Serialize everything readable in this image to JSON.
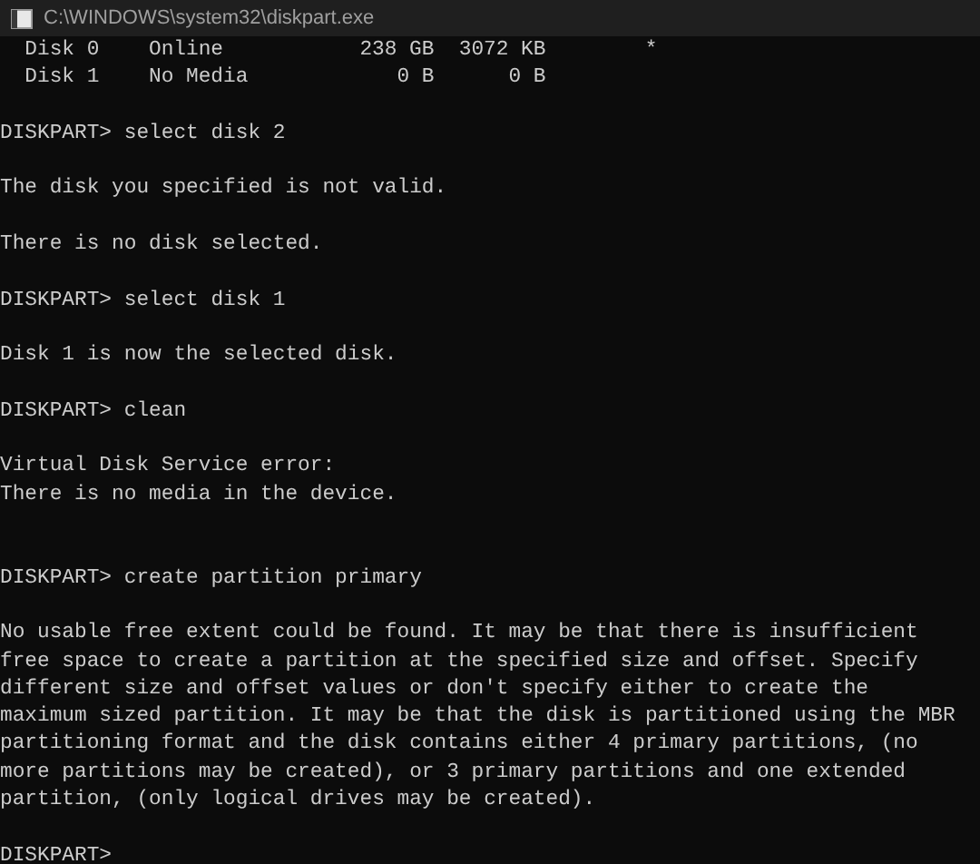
{
  "window": {
    "title": "C:\\WINDOWS\\system32\\diskpart.exe"
  },
  "disk_table": {
    "rows": [
      {
        "disk": "Disk 0",
        "status": "Online",
        "size": "238 GB",
        "free": "3072 KB",
        "gpt": "*"
      },
      {
        "disk": "Disk 1",
        "status": "No Media",
        "size": "0 B",
        "free": "0 B"
      }
    ]
  },
  "blocks": [
    {
      "lines": [
        "DISKPART> select disk 2"
      ],
      "extra_blank": false
    },
    {
      "lines": [
        "The disk you specified is not valid."
      ],
      "extra_blank": false
    },
    {
      "lines": [
        "There is no disk selected."
      ],
      "extra_blank": false
    },
    {
      "lines": [
        "DISKPART> select disk 1"
      ],
      "extra_blank": false
    },
    {
      "lines": [
        "Disk 1 is now the selected disk."
      ],
      "extra_blank": false
    },
    {
      "lines": [
        "DISKPART> clean"
      ],
      "extra_blank": false
    },
    {
      "lines": [
        "Virtual Disk Service error:",
        "There is no media in the device."
      ],
      "extra_blank": true
    },
    {
      "lines": [
        "DISKPART> create partition primary"
      ],
      "extra_blank": false
    },
    {
      "lines": [
        "No usable free extent could be found. It may be that there is insufficient",
        "free space to create a partition at the specified size and offset. Specify",
        "different size and offset values or don't specify either to create the",
        "maximum sized partition. It may be that the disk is partitioned using the MBR",
        "partitioning format and the disk contains either 4 primary partitions, (no",
        "more partitions may be created), or 3 primary partitions and one extended",
        "partition, (only logical drives may be created)."
      ],
      "extra_blank": false
    },
    {
      "lines": [
        "DISKPART>"
      ],
      "extra_blank": false
    }
  ]
}
